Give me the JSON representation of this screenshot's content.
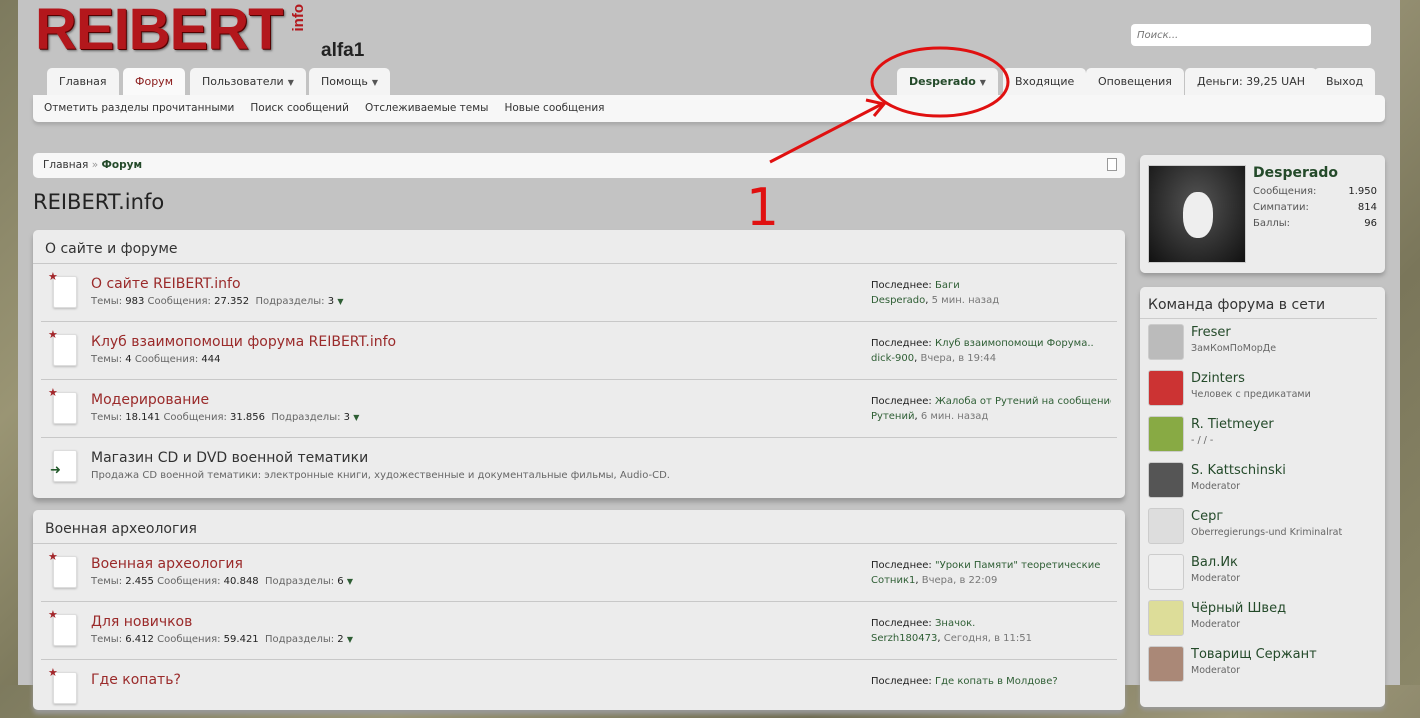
{
  "header": {
    "logo": "REIBERT",
    "logo_suffix": "info",
    "logo_sub": "alfa1",
    "search_placeholder": "Поиск..."
  },
  "nav": {
    "tabs": [
      {
        "label": "Главная"
      },
      {
        "label": "Форум"
      },
      {
        "label": "Пользователи"
      },
      {
        "label": "Помощь"
      }
    ],
    "user_tabs": [
      {
        "label": "Desperado"
      },
      {
        "label": "Входящие"
      },
      {
        "label": "Оповещения"
      },
      {
        "label": "Деньги: 39,25 UAH"
      },
      {
        "label": "Выход"
      }
    ],
    "subnav": [
      "Отметить разделы прочитанными",
      "Поиск сообщений",
      "Отслеживаемые темы",
      "Новые сообщения"
    ]
  },
  "breadcrumb": {
    "home": "Главная",
    "sep": "»",
    "current": "Форум"
  },
  "page_title": "REIBERT.info",
  "annotation": {
    "label": "1",
    "color": "#e01010"
  },
  "labels": {
    "topics": "Темы:",
    "messages": "Сообщения:",
    "subforums": "Подразделы:",
    "last": "Последнее:"
  },
  "categories": [
    {
      "title": "О сайте и форуме",
      "forums": [
        {
          "name": "О сайте REIBERT.info",
          "topics": "983",
          "messages": "27.352",
          "subforums": "3",
          "last_title": "Баги",
          "last_user": "Desperado",
          "last_time": "5 мин. назад"
        },
        {
          "name": "Клуб взаимопомощи форума REIBERT.info",
          "topics": "4",
          "messages": "444",
          "last_title": "Клуб взаимопомощи Форума..",
          "last_user": "dick-900",
          "last_time": "Вчера, в 19:44"
        },
        {
          "name": "Модерирование",
          "topics": "18.141",
          "messages": "31.856",
          "subforums": "3",
          "last_title": "Жалоба от Рутений на сообщение",
          "last_user": "Рутений",
          "last_time": "6 мин. назад"
        },
        {
          "name": "Магазин CD и DVD военной тематики",
          "description": "Продажа CD военной тематики: электронные книги, художественные и документальные фильмы, Audio-CD."
        }
      ]
    },
    {
      "title": "Военная археология",
      "forums": [
        {
          "name": "Военная археология",
          "topics": "2.455",
          "messages": "40.848",
          "subforums": "6",
          "last_title": "\"Уроки Памяти\" теоретические",
          "last_user": "Сотник1",
          "last_time": "Вчера, в 22:09"
        },
        {
          "name": "Для новичков",
          "topics": "6.412",
          "messages": "59.421",
          "subforums": "2",
          "last_title": "Значок.",
          "last_user": "Serzh180473",
          "last_time": "Сегодня, в 11:51"
        },
        {
          "name": "Где копать?",
          "last_title": "Где копать в Молдове?"
        }
      ]
    }
  ],
  "profile": {
    "name": "Desperado",
    "stats": [
      {
        "label": "Сообщения:",
        "value": "1.950"
      },
      {
        "label": "Симпатии:",
        "value": "814"
      },
      {
        "label": "Баллы:",
        "value": "96"
      }
    ]
  },
  "staff": {
    "title": "Команда форума в сети",
    "members": [
      {
        "name": "Freser",
        "title": "ЗамКомПоМорДе"
      },
      {
        "name": "Dzinters",
        "title": "Человек с предикатами"
      },
      {
        "name": "R. Tietmeyer",
        "title": "- / / -"
      },
      {
        "name": "S. Kattschinski",
        "title": "Moderator"
      },
      {
        "name": "Серг",
        "title": "Oberregierungs-und Kriminalrat"
      },
      {
        "name": "Вал.Ик",
        "title": "Moderator"
      },
      {
        "name": "Чёрный Швед",
        "title": "Moderator"
      },
      {
        "name": "Товарищ Сержант",
        "title": "Moderator"
      }
    ]
  }
}
